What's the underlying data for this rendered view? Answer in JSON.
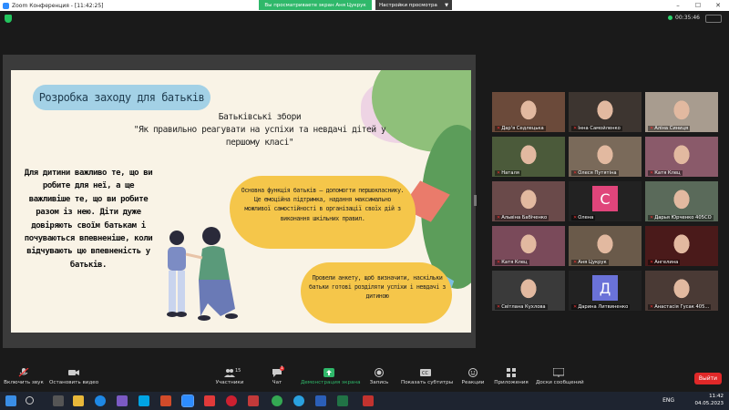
{
  "window": {
    "title": "Zoom Конференция - [11:42:25]",
    "controls": [
      "–",
      "☐",
      "✕"
    ]
  },
  "share": {
    "banner": "Вы просматриваете экран Аня Цукрук",
    "view_settings": "Настройки просмотра"
  },
  "meeting": {
    "timer": "00:35:46"
  },
  "slide": {
    "title": "Розробка заходу для батьків",
    "heading_line1": "Батьківські збори",
    "heading_line2": "\"Як правильно реагувати на успіхи та невдачі дітей у першому класі\"",
    "left_text": "Для дитини важливо те, що ви робите для неї, а ще важливіше те, що ви робите разом із нею. Діти дуже довіряють своїм батькам і почуваються впевненіше, коли відчувають цю впевненість у батьків.",
    "box1": "Основна функція батьків — допомогти першокласнику. Це емоційна підтримка, надання максимально можливої самостійності в організації своїх дій з виконання шкільних правил.",
    "box2": "Провели анкету, щоб визначити, наскільки батьки готові розділяти успіхи і невдачі з дитиною"
  },
  "participants": [
    {
      "name": "Дар'я Седлецька",
      "color": "#6b4a3a"
    },
    {
      "name": "Інна Самойленко",
      "color": "#3d3530"
    },
    {
      "name": "Аліна Синиця",
      "color": "#a89c8f"
    },
    {
      "name": "Наталя",
      "color": "#4b5a3a"
    },
    {
      "name": "Олеся Путятіна",
      "color": "#7a6a5a"
    },
    {
      "name": "Катя Клец",
      "color": "#8a5a6a"
    },
    {
      "name": "Альвіна Бабіченко",
      "color": "#6a4a4a"
    },
    {
      "name": "Олена",
      "color": "#e0457b",
      "letter": "C"
    },
    {
      "name": "Дарья Юрченко 405СО",
      "color": "#5a6a5a"
    },
    {
      "name": "Катя Клец",
      "color": "#7a4a5a"
    },
    {
      "name": "Аня Цукрук",
      "color": "#6a5a4a"
    },
    {
      "name": "Ангелина",
      "color": "#4a1a1a"
    },
    {
      "name": "Світлана Кухлова",
      "color": "#3a3a3a"
    },
    {
      "name": "Дарина Литвиненко",
      "color": "#6a72d8",
      "letter": "Д"
    },
    {
      "name": "Анастасія Гусак 405...",
      "color": "#4a3a35"
    }
  ],
  "toolbar": {
    "audio": "Включить звук",
    "video": "Остановить видео",
    "participants": "Участники",
    "participants_count": "15",
    "chat": "Чат",
    "chat_badge": "1",
    "share": "Демонстрация экрана",
    "record": "Запись",
    "captions": "Показать субтитры",
    "reactions": "Реакции",
    "apps": "Приложения",
    "whiteboard": "Доски сообщений",
    "leave": "Выйти"
  },
  "tray": {
    "lang": "ENG",
    "time": "11:42",
    "date": "04.05.2023"
  },
  "colors": {
    "accent_green": "#2fb86a",
    "leave_red": "#e02828",
    "slide_bg": "#f9f3e6",
    "pill_blue": "#a3d1e6",
    "box_yellow": "#f5c64a"
  }
}
